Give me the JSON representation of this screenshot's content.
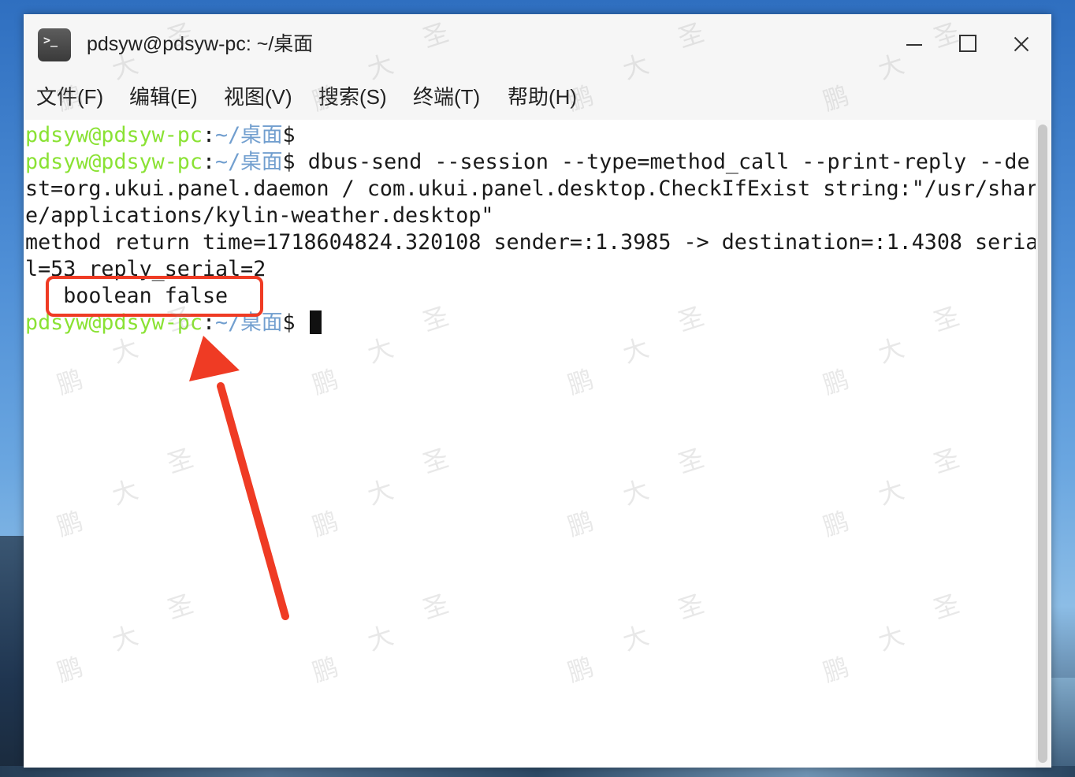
{
  "window": {
    "title": "pdsyw@pdsyw-pc: ~/桌面",
    "app_icon_glyph": ">_"
  },
  "menubar": {
    "items": [
      {
        "label": "文件(F)"
      },
      {
        "label": "编辑(E)"
      },
      {
        "label": "视图(V)"
      },
      {
        "label": "搜索(S)"
      },
      {
        "label": "终端(T)"
      },
      {
        "label": "帮助(H)"
      }
    ]
  },
  "terminal": {
    "prompt": {
      "user_host": "pdsyw@pdsyw-pc",
      "separator": ":",
      "path": "~/桌面",
      "dollar": "$ "
    },
    "lines": {
      "cmd_line_1": "dbus-send --session --type=method_call --print-reply --de",
      "cmd_line_2": "st=org.ukui.panel.daemon / com.ukui.panel.desktop.CheckIfExist string:\"/usr/shar",
      "cmd_line_3": "e/applications/kylin-weather.desktop\"",
      "output_line_1": "method return time=1718604824.320108 sender=:1.3985 -> destination=:1.4308 seria",
      "output_line_2": "l=53 reply_serial=2",
      "output_line_3": "   boolean false"
    }
  },
  "annotation": {
    "color": "#ef3b24"
  },
  "watermark": {
    "text": "鹏大圣",
    "glyphs": [
      "鹏",
      "大",
      "圣"
    ]
  },
  "colors": {
    "prompt_user": "#8ae234",
    "prompt_path": "#729fcf"
  }
}
